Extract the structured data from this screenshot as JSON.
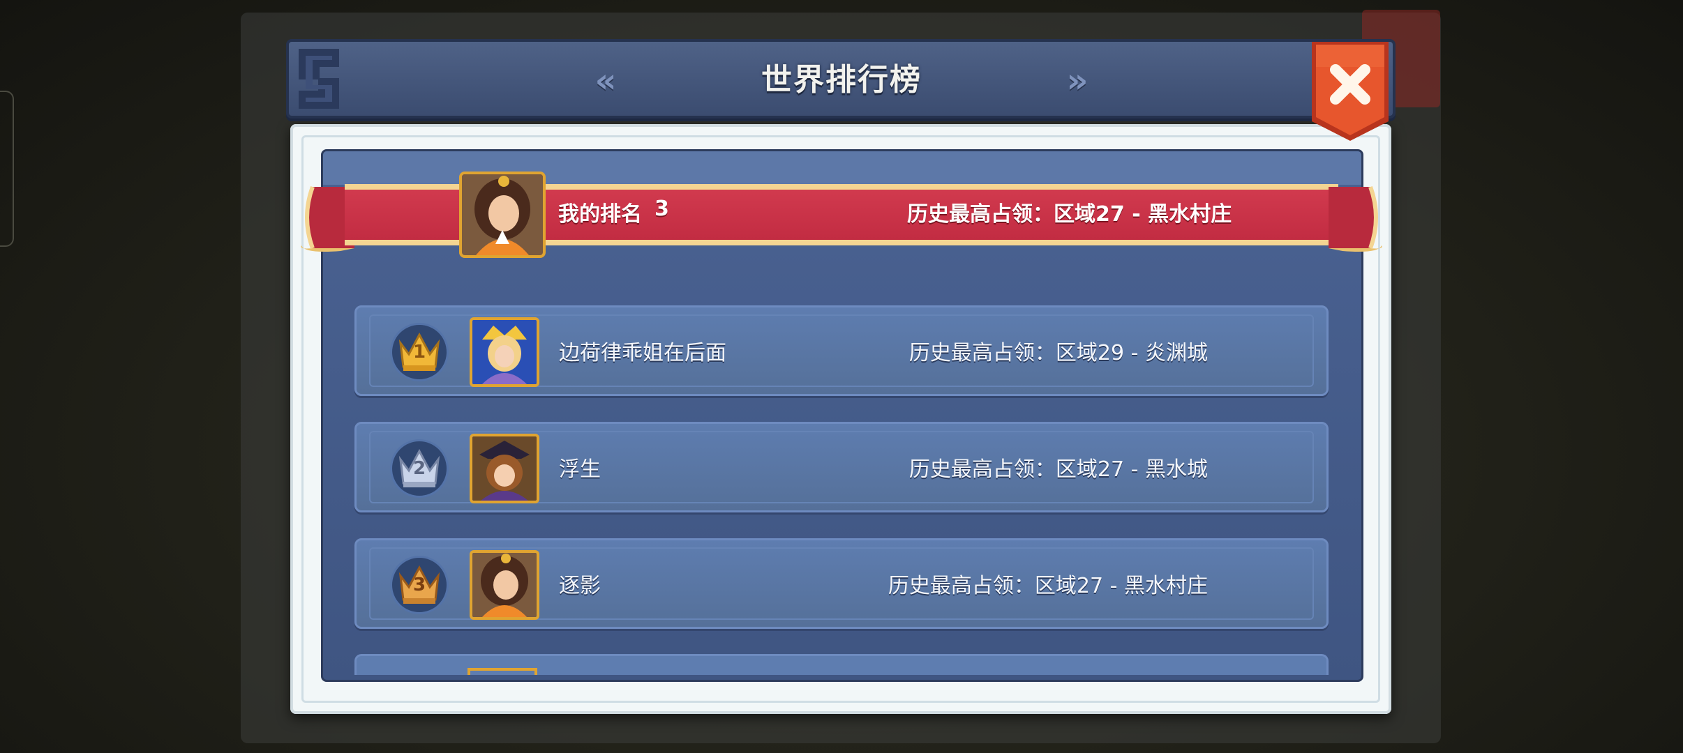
{
  "header": {
    "title": "世界排行榜",
    "prev_label": "«",
    "next_label": "»"
  },
  "colors": {
    "header_bg": "#4a5c82",
    "board_bg": "#4a6292",
    "row_bg": "#5e7db0",
    "ribbon_red": "#c93247",
    "ribbon_gold": "#f4d592",
    "close_red": "#e2512b",
    "gold": "#f1b838",
    "silver": "#b9c6de",
    "bronze": "#e1a145"
  },
  "my_rank": {
    "label": "我的排名",
    "rank": "3",
    "history": "历史最高占领：区域27 - 黑水村庄",
    "avatar_icon": "hero-portrait-icon"
  },
  "rows": [
    {
      "rank": "1",
      "crown": "gold-crown-icon",
      "name": "边荷律乖姐在后面",
      "history": "历史最高占领：区域29 - 炎渊城"
    },
    {
      "rank": "2",
      "crown": "silver-crown-icon",
      "name": "浮生",
      "history": "历史最高占领：区域27 - 黑水城"
    },
    {
      "rank": "3",
      "crown": "bronze-crown-icon",
      "name": "逐影",
      "history": "历史最高占领：区域27 - 黑水村庄"
    }
  ]
}
